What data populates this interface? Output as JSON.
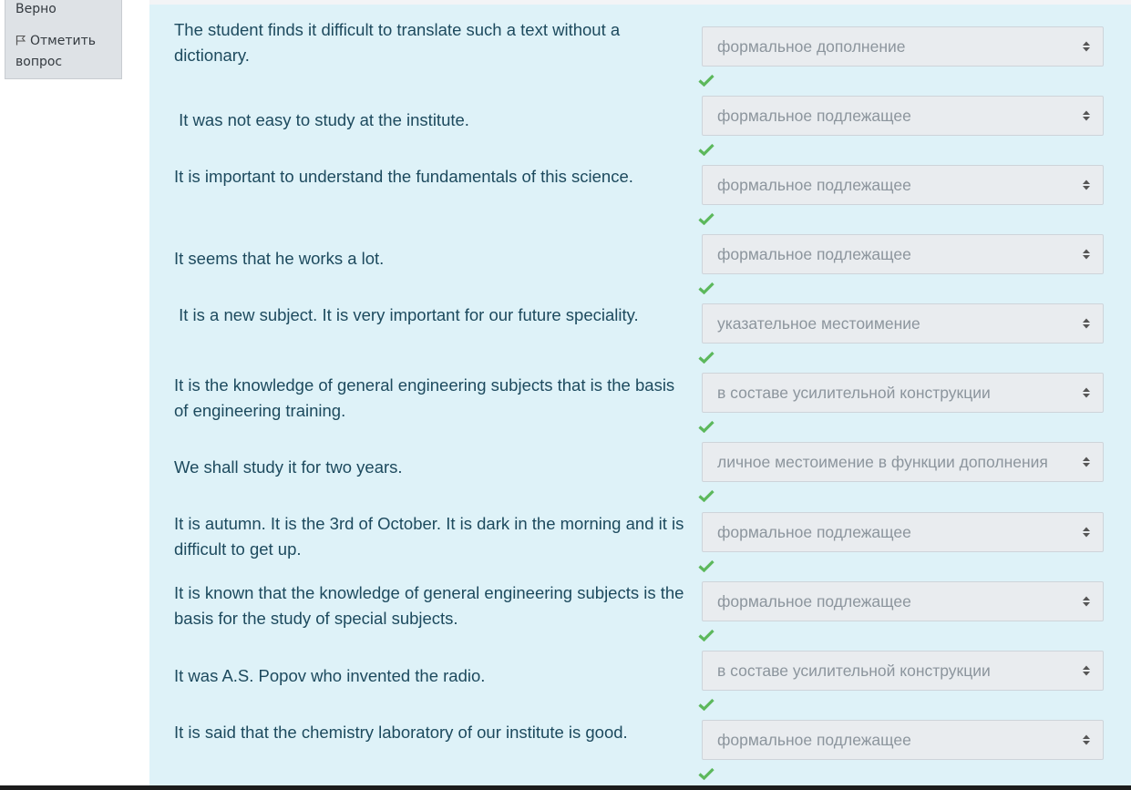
{
  "info": {
    "state": "Верно",
    "flag_label": "Отметить вопрос"
  },
  "questions": [
    {
      "text": "The student finds it difficult to translate such a text without a dictionary.",
      "answer": "формальное дополнение"
    },
    {
      "text": " It was not easy to study at the institute.",
      "answer": "формальное подлежащее"
    },
    {
      "text": "It is important to understand the fundamentals of this science.",
      "answer": "формальное подлежащее"
    },
    {
      "text": "It seems that he works a lot.",
      "answer": "формальное подлежащее"
    },
    {
      "text": " It is a new subject. It is very important for our future speciality.",
      "answer": "указательное местоимение"
    },
    {
      "text": "It is the knowledge of general engineering subjects that is the basis of engineering training.",
      "answer": "в составе усилительной конструкции"
    },
    {
      "text": "We shall study it for two years.",
      "answer": "личное местоимение в функции дополнения"
    },
    {
      "text": "It is autumn. It is the 3rd of October. It is dark in the morning and it is difficult to get up.",
      "answer": "формальное подлежащее"
    },
    {
      "text": "It is known that the knowledge of general engineering subjects is the basis for the study of special subjects.",
      "answer": "формальное подлежащее"
    },
    {
      "text": "It was A.S. Popov who invented the radio.",
      "answer": "в составе усилительной конструкции"
    },
    {
      "text": "It is said that the chemistry laboratory of our institute is good.",
      "answer": "формальное подлежащее"
    }
  ],
  "colors": {
    "panel_bg": "#def2f8",
    "text": "#1d4a5e",
    "select_bg": "#e9ecef",
    "select_text": "#8c959d",
    "check": "#5cb85c"
  },
  "icons": {
    "flag": "flag-icon",
    "caret": "select-caret-icon",
    "check": "check-icon"
  }
}
